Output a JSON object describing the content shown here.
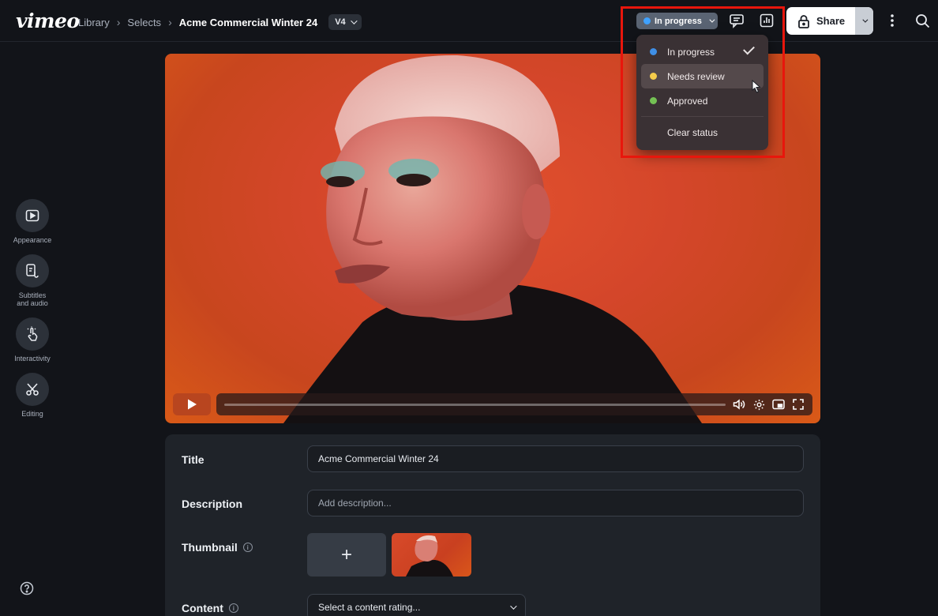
{
  "app": {
    "logo": "vimeo"
  },
  "breadcrumb": {
    "items": [
      "Library",
      "Selects"
    ],
    "current": "Acme Commercial Winter 24",
    "version": "V4"
  },
  "status": {
    "current_label": "In progress",
    "current_color": "#3fa2ff",
    "options": [
      {
        "label": "In progress",
        "color": "#3f8fe6",
        "selected": true
      },
      {
        "label": "Needs review",
        "color": "#f5cc4b",
        "selected": false,
        "hovered": true
      },
      {
        "label": "Approved",
        "color": "#74c154",
        "selected": false
      }
    ],
    "clear_label": "Clear status"
  },
  "toolbar": {
    "share_label": "Share"
  },
  "rail": {
    "items": [
      {
        "label": "Appearance",
        "icon": "play-square-icon"
      },
      {
        "label": "Subtitles and audio",
        "icon": "captions-audio-icon"
      },
      {
        "label": "Interactivity",
        "icon": "tap-hand-icon"
      },
      {
        "label": "Editing",
        "icon": "scissors-icon"
      }
    ]
  },
  "details": {
    "title_label": "Title",
    "title_value": "Acme Commercial Winter 24",
    "description_label": "Description",
    "description_placeholder": "Add description...",
    "thumbnail_label": "Thumbnail",
    "content_label": "Content",
    "content_placeholder": "Select a content rating..."
  },
  "colors": {
    "accent_red": "#e8160c",
    "video_bg": "#d4462a"
  }
}
